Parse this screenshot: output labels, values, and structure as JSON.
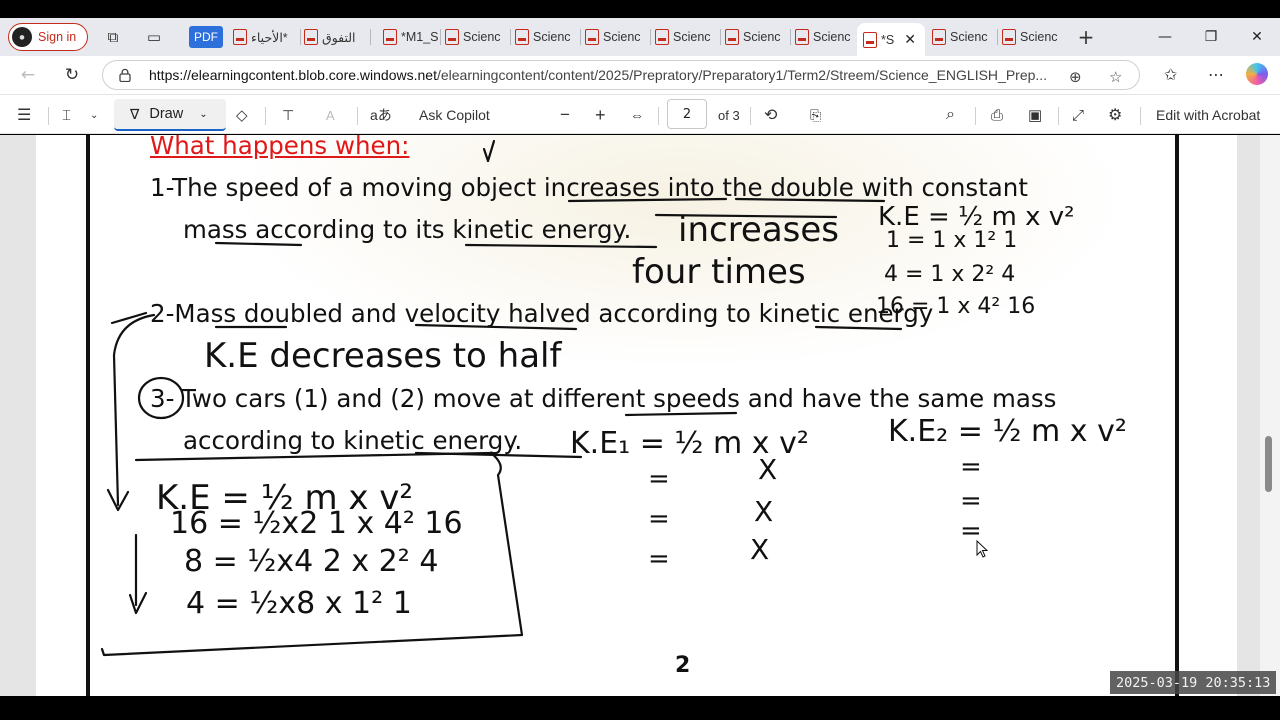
{
  "browser": {
    "signin_label": "Sign in",
    "pdf_badge": "PDF",
    "tabs": [
      {
        "label": "الأحياء*"
      },
      {
        "label": "التفوق"
      },
      {
        "label": "*M1_S"
      },
      {
        "label": "Scienc"
      },
      {
        "label": "Scienc"
      },
      {
        "label": "Scienc"
      },
      {
        "label": "Scienc"
      },
      {
        "label": "Scienc"
      },
      {
        "label": "Scienc"
      },
      {
        "label": "*S"
      },
      {
        "label": "Scienc"
      },
      {
        "label": "Scienc"
      }
    ],
    "url_host": "https://elearningcontent.blob.core.windows.net",
    "url_path": "/elearningcontent/content/2025/Prepratory/Preparatory1/Term2/Streem/Science_ENGLISH_Prep..."
  },
  "pdf_toolbar": {
    "draw_label": "Draw",
    "ask_copilot": "Ask Copilot",
    "page_current": "2",
    "page_total": "of 3",
    "edit_acrobat": "Edit with Acrobat"
  },
  "document": {
    "heading": "What happens when:",
    "q1_line1": "1-The speed of a moving object increases into the double with constant",
    "q1_line2": "mass according to its kinetic energy.",
    "q2_line1": "2-Mass doubled and velocity halved according to kinetic energy",
    "q3_line1": "Two cars (1) and (2) move at different speeds and have the same mass",
    "q3_number": "3-",
    "q3_line2": "according to kinetic energy.",
    "page_number": "2"
  },
  "handwriting": {
    "a1": "increases",
    "a1b": "four times",
    "a2": "K.E decreases to half",
    "eq1": "K.E = ½ m x v²",
    "eq1_row1": "1 = 1 x 1² 1",
    "eq1_row2": "4 = 1 x 2² 4",
    "eq1_row3": "16 = 1 x 4² 16",
    "eq3a": "K.E₁ = ½ m x v²",
    "eq3b": "K.E₂ = ½ m x v²",
    "box_eq": "K.E = ½ m x v²",
    "box_row1": "16 = ½x2 1 x 4² 16",
    "box_row2": "8 = ½x4 2 x 2² 4",
    "box_row3": "4 = ½x8 x 1² 1"
  },
  "timestamp": "2025-03-19  20:35:13"
}
